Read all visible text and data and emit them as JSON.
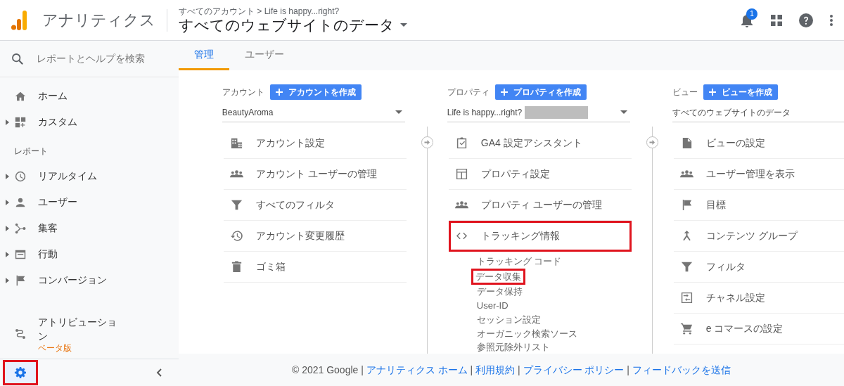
{
  "header": {
    "product": "アナリティクス",
    "breadcrumb": "すべてのアカウント > Life is happy...right?",
    "view_title": "すべてのウェブサイトのデータ",
    "notification_count": "1"
  },
  "sidebar": {
    "search_placeholder": "レポートとヘルプを検索",
    "top_items": [
      {
        "label": "ホーム",
        "expandable": false
      },
      {
        "label": "カスタム",
        "expandable": true
      }
    ],
    "section_label": "レポート",
    "report_items": [
      {
        "label": "リアルタイム",
        "expandable": true
      },
      {
        "label": "ユーザー",
        "expandable": true
      },
      {
        "label": "集客",
        "expandable": true
      },
      {
        "label": "行動",
        "expandable": true
      },
      {
        "label": "コンバージョン",
        "expandable": true
      }
    ],
    "attribution": {
      "label": "アトリビューション",
      "badge": "ベータ版"
    },
    "settings": {
      "selected": true,
      "highlighted": true
    }
  },
  "tabs": [
    {
      "label": "管理",
      "selected": true
    },
    {
      "label": "ユーザー",
      "selected": false
    }
  ],
  "columns": [
    {
      "label": "アカウント",
      "button": "アカウントを作成",
      "selector": {
        "value": "BeautyAroma",
        "redacted": false
      },
      "items": [
        {
          "label": "アカウント設定",
          "highlighted": false
        },
        {
          "label": "アカウント ユーザーの管理",
          "highlighted": false
        },
        {
          "label": "すべてのフィルタ",
          "highlighted": false
        },
        {
          "label": "アカウント変更履歴",
          "highlighted": false
        },
        {
          "label": "ゴミ箱",
          "highlighted": false
        }
      ]
    },
    {
      "label": "プロパティ",
      "button": "プロパティを作成",
      "selector": {
        "value": "Life is happy...right?",
        "redacted": true
      },
      "items": [
        {
          "label": "GA4 設定アシスタント",
          "highlighted": false
        },
        {
          "label": "プロパティ設定",
          "highlighted": false
        },
        {
          "label": "プロパティ ユーザーの管理",
          "highlighted": false
        },
        {
          "label": "トラッキング情報",
          "highlighted": true,
          "children": [
            {
              "label": "トラッキング コード",
              "highlighted": false
            },
            {
              "label": "データ収集",
              "highlighted": true
            },
            {
              "label": "データ保持",
              "highlighted": false
            },
            {
              "label": "User-ID",
              "highlighted": false
            },
            {
              "label": "セッション設定",
              "highlighted": false
            },
            {
              "label": "オーガニック検索ソース",
              "highlighted": false
            },
            {
              "label": "参照元除外リスト",
              "highlighted": false
            }
          ]
        }
      ]
    },
    {
      "label": "ビュー",
      "button": "ビューを作成",
      "selector": {
        "value": "すべてのウェブサイトのデータ",
        "redacted": false
      },
      "items": [
        {
          "label": "ビューの設定",
          "highlighted": false
        },
        {
          "label": "ユーザー管理を表示",
          "highlighted": false
        },
        {
          "label": "目標",
          "highlighted": false
        },
        {
          "label": "コンテンツ グループ",
          "highlighted": false
        },
        {
          "label": "フィルタ",
          "highlighted": false
        },
        {
          "label": "チャネル設定",
          "highlighted": false
        },
        {
          "label": "e コマースの設定",
          "highlighted": false
        }
      ]
    }
  ],
  "footer": {
    "copyright": "© 2021 Google",
    "separator": "|",
    "links": [
      "アナリティクス ホーム",
      "利用規約",
      "プライバシー ポリシー",
      "フィードバックを送信"
    ]
  }
}
